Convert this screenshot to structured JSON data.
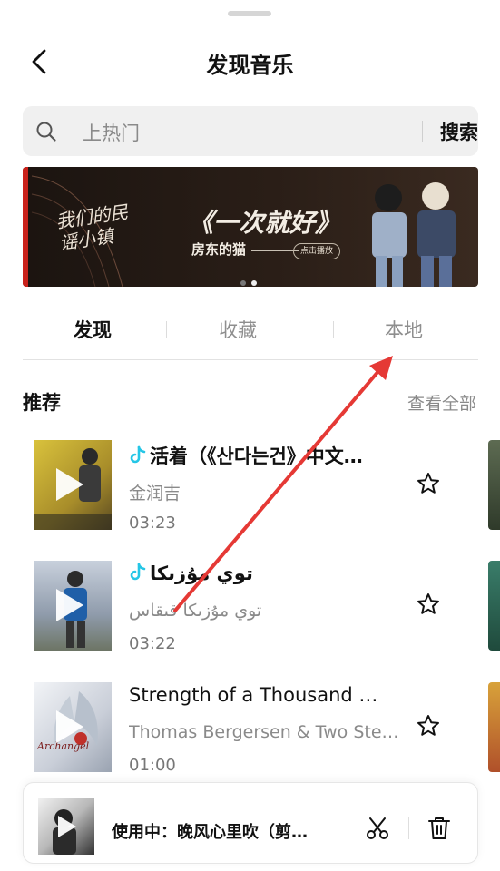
{
  "header": {
    "title": "发现音乐"
  },
  "search": {
    "placeholder": "上热门",
    "button_label": "搜索"
  },
  "banner": {
    "logo_text": "我们的民谣小镇",
    "song_title": "《一次就好》",
    "artist": "房东的猫",
    "play_pill": "点击播放",
    "active_slide": 2,
    "slide_count": 2
  },
  "tabs": [
    {
      "label": "发现",
      "active": true
    },
    {
      "label": "收藏",
      "active": false
    },
    {
      "label": "本地",
      "active": false
    }
  ],
  "recommend": {
    "title": "推荐",
    "see_all": "查看全部"
  },
  "songs": [
    {
      "title": "活着（《산다는건》中文…",
      "artist": "金润吉",
      "duration": "03:23",
      "tiktok": true,
      "cover_color": "#c8b23a"
    },
    {
      "title": "توي مۇزىكا",
      "artist": "توي مۇزىكا قىقاس",
      "duration": "03:22",
      "tiktok": true,
      "cover_color": "#8a9ab0"
    },
    {
      "title": "Strength of a Thousand …",
      "artist": "Thomas Bergersen & Two Step…",
      "duration": "01:00",
      "tiktok": false,
      "cover_color": "#dfe3ea"
    }
  ],
  "player": {
    "label": "使用中：晚风心里吹（剪…"
  },
  "colors": {
    "annotation_arrow": "#e53935",
    "banner_accent": "#c9221b",
    "tiktok_cyan": "#25c6e6"
  }
}
